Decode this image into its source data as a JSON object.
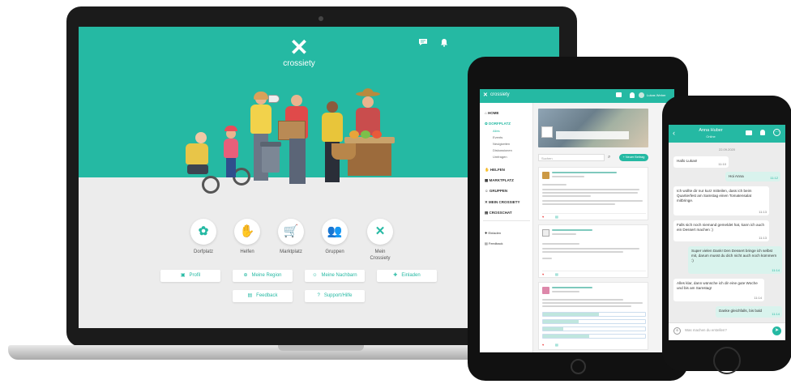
{
  "laptop": {
    "brand": "crossiety",
    "logo_glyph": "✕",
    "top_icons": [
      "chat-icon",
      "bell-icon"
    ],
    "categories": [
      {
        "label": "Dorfplatz",
        "icon": "gear-icon",
        "glyph": "✿"
      },
      {
        "label": "Helfen",
        "icon": "helping-hand-icon",
        "glyph": "✋"
      },
      {
        "label": "Marktplatz",
        "icon": "basket-icon",
        "glyph": "🛒"
      },
      {
        "label": "Gruppen",
        "icon": "group-icon",
        "glyph": "👥"
      },
      {
        "label": "Mein\nCrossiety",
        "icon": "crossiety-x-icon",
        "glyph": "✕"
      }
    ],
    "buttons_row1": [
      {
        "label": "Profil",
        "icon": "id-card-icon",
        "glyph": "▣"
      },
      {
        "label": "Meine Region",
        "icon": "region-icon",
        "glyph": "⊕"
      },
      {
        "label": "Meine Nachbarn",
        "icon": "neighbours-icon",
        "glyph": "☺"
      },
      {
        "label": "Einladen",
        "icon": "invite-icon",
        "glyph": "✚"
      }
    ],
    "buttons_row2": [
      {
        "label": "Feedback",
        "icon": "feedback-icon",
        "glyph": "▤"
      },
      {
        "label": "Support/Hilfe",
        "icon": "help-icon",
        "glyph": "?"
      }
    ],
    "accent": "#25b9a3"
  },
  "tablet": {
    "brand": "crossiety",
    "user": "Lukas Weber",
    "nav": [
      {
        "label": "HOME",
        "icon": "home-icon"
      },
      {
        "label": "DORFPLATZ",
        "icon": "gear-icon",
        "active": true
      },
      {
        "label": "HELFEN",
        "icon": "helping-hand-icon"
      },
      {
        "label": "MARKTPLATZ",
        "icon": "basket-icon"
      },
      {
        "label": "GRUPPEN",
        "icon": "group-icon"
      },
      {
        "label": "MEIN CROSSIETY",
        "icon": "crossiety-x-icon"
      },
      {
        "label": "CROSSCHAT",
        "icon": "chat-icon"
      }
    ],
    "sub_nav": [
      "Alles",
      "Events",
      "Neuigkeiten",
      "Diskussionen",
      "Umfragen"
    ],
    "extra_nav": [
      "Einladen",
      "Feedback"
    ],
    "search_placeholder": "Suchen",
    "new_post_button": "+ Neuer Beitrag",
    "poll_rows": 4
  },
  "phone": {
    "contact": "Anna Huber",
    "status": "Online",
    "date": "22.09.2020",
    "placeholder": "Was machen du erstellen?",
    "messages": [
      {
        "text": "Hallo Lukas!",
        "time": "11:10",
        "mine": false
      },
      {
        "text": "Hoi Anna",
        "time": "11:12",
        "mine": true
      },
      {
        "text": "Ich wollte dir nur kurz mitteilen, dass ich beim Quartierfest am Samstag einen Tomatensalat mitbringe.",
        "time": "11:13",
        "mine": false
      },
      {
        "text": "Falls sich noch niemand gemeldet hat, kann ich auch ein Dessert machen :)",
        "time": "11:13",
        "mine": false
      },
      {
        "text": "Super vielen Dank! Den Dessert bringe ich selbst mit, darum musst du dich nicht auch noch kümmern :)",
        "time": "11:14",
        "mine": true
      },
      {
        "text": "Alles klar, dann wünsche ich dir eine gute Woche und bis am Samstag!",
        "time": "11:14",
        "mine": false
      },
      {
        "text": "Danke gleichfalls, bis bald",
        "time": "11:14",
        "mine": true
      }
    ]
  }
}
